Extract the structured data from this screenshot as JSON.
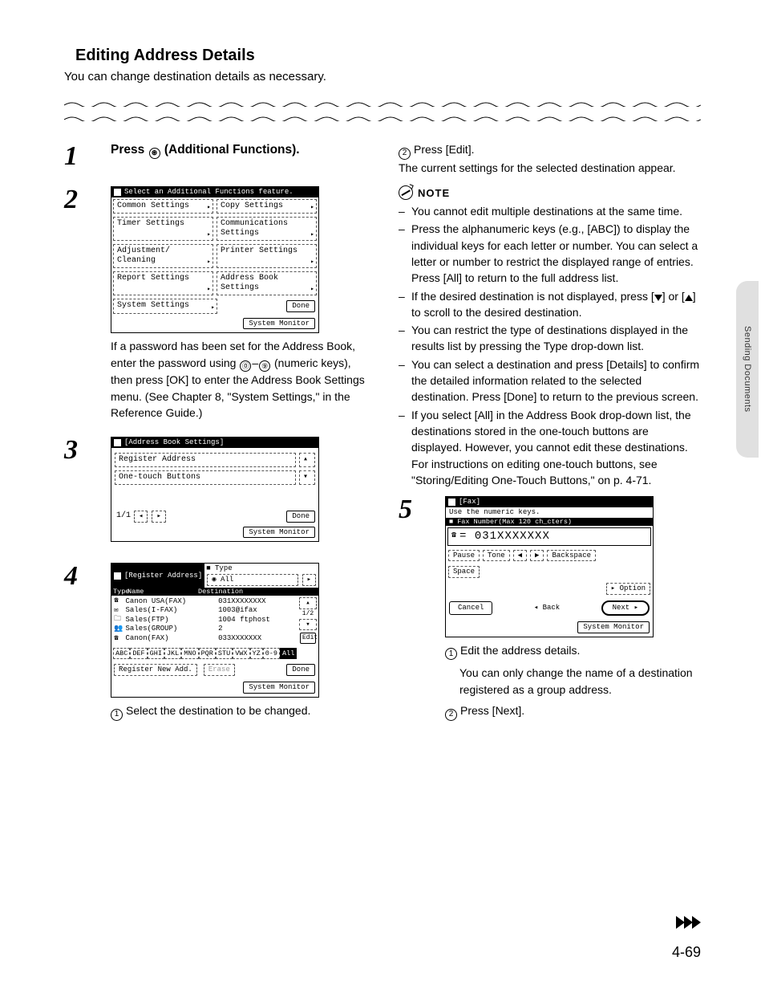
{
  "side_tab": "Sending Documents",
  "section_title": "Editing Address Details",
  "intro": "You can change destination details as necessary.",
  "step1": {
    "number": "1",
    "heading_prefix": "Press ",
    "heading_glyph": "⊛",
    "heading_suffix": " (Additional Functions)."
  },
  "step2": {
    "number": "2",
    "panel": {
      "title": "Select an Additional Functions feature.",
      "cells": [
        [
          "Common Settings",
          "Copy Settings"
        ],
        [
          "Timer Settings",
          "Communications Settings"
        ],
        [
          "Adjustment/ Cleaning",
          "Printer Settings"
        ],
        [
          "Report Settings",
          "Address Book Settings"
        ],
        [
          "System Settings",
          ""
        ]
      ],
      "done": "Done",
      "footer": "System Monitor"
    },
    "para_a": "If a password has been set for the Address Book, enter the password using ",
    "para_keys_a": "⓪",
    "para_keys_dash": "–",
    "para_keys_b": "⑨",
    "para_b": " (numeric keys), then press [OK] to enter the Address Book Settings menu. (See Chapter 8, \"System Settings,\" in the Reference Guide.)"
  },
  "step3": {
    "number": "3",
    "panel": {
      "breadcrumb": "[Address Book Settings]",
      "items": [
        "Register Address",
        "One-touch Buttons"
      ],
      "page": "1/1",
      "done": "Done",
      "footer": "System Monitor"
    }
  },
  "step4": {
    "number": "4",
    "panel": {
      "breadcrumb": "[Register Address]",
      "type_label": "■ Type",
      "type_value": "◉ All",
      "head_type": "Type",
      "head_name": "Name",
      "head_dest": "Destination",
      "rows": [
        {
          "icon": "☎",
          "name": "Canon USA(FAX)",
          "dest": "031XXXXXXXX"
        },
        {
          "icon": "✉",
          "name": "Sales(I-FAX)",
          "dest": "1003@ifax"
        },
        {
          "icon": "🗀",
          "name": "Sales(FTP)",
          "dest": "1004 ftphost"
        },
        {
          "icon": "👥",
          "name": "Sales(GROUP)",
          "dest": "2"
        },
        {
          "icon": "☎",
          "name": "Canon(FAX)",
          "dest": "033XXXXXXX"
        }
      ],
      "page": "1/2",
      "edit": "Edit",
      "alpha": [
        "ABC",
        "DEF",
        "GHI",
        "JKL",
        "MNO",
        "PQR",
        "STU",
        "VWX",
        "YZ",
        "0-9",
        "All"
      ],
      "reg_new": "Register New Add.",
      "erase": "Erase",
      "done": "Done",
      "footer": "System Monitor"
    },
    "caption": "Select the destination to be changed."
  },
  "right_top": {
    "circ": "②",
    "press_edit": "Press [Edit].",
    "line2": "The current settings for the selected destination appear."
  },
  "note": {
    "label": "NOTE",
    "items": [
      "You cannot edit multiple destinations at the same time.",
      "Press the alphanumeric keys (e.g., [ABC]) to display the individual keys for each letter or number. You can select a letter or number to restrict the displayed range of entries. Press [All] to return to the full address list.",
      "If the desired destination is not displayed, press [▼] or [▲] to scroll to the desired destination.",
      "You can restrict the type of destinations displayed in the results list by pressing the Type drop-down list.",
      "You can select a destination and press [Details] to confirm the detailed information related to the selected destination. Press [Done] to return to the previous screen.",
      "If you select [All] in the Address Book drop-down list, the destinations stored in the one-touch buttons are displayed. However, you cannot edit these destinations. For instructions on editing one-touch buttons, see \"Storing/Editing One-Touch Buttons,\" on p. 4-71."
    ]
  },
  "step5": {
    "number": "5",
    "panel": {
      "breadcrumb": "[Fax]",
      "hint": "Use the numeric keys.",
      "field_label": "■ Fax Number(Max 120 ch_cters)",
      "phone_icon": "☎",
      "phone_value": "= 031XXXXXXX",
      "row_btns": [
        "Pause",
        "Tone",
        "◀",
        "▶",
        "Backspace"
      ],
      "space": "Space",
      "option": "Option",
      "cancel": "Cancel",
      "back": "Back",
      "next": "Next",
      "footer": "System Monitor"
    },
    "c1": "Edit the address details.",
    "c1_note": "You can only change the name of a destination registered as a group address.",
    "c2": "Press [Next]."
  },
  "page_number": "4-69"
}
